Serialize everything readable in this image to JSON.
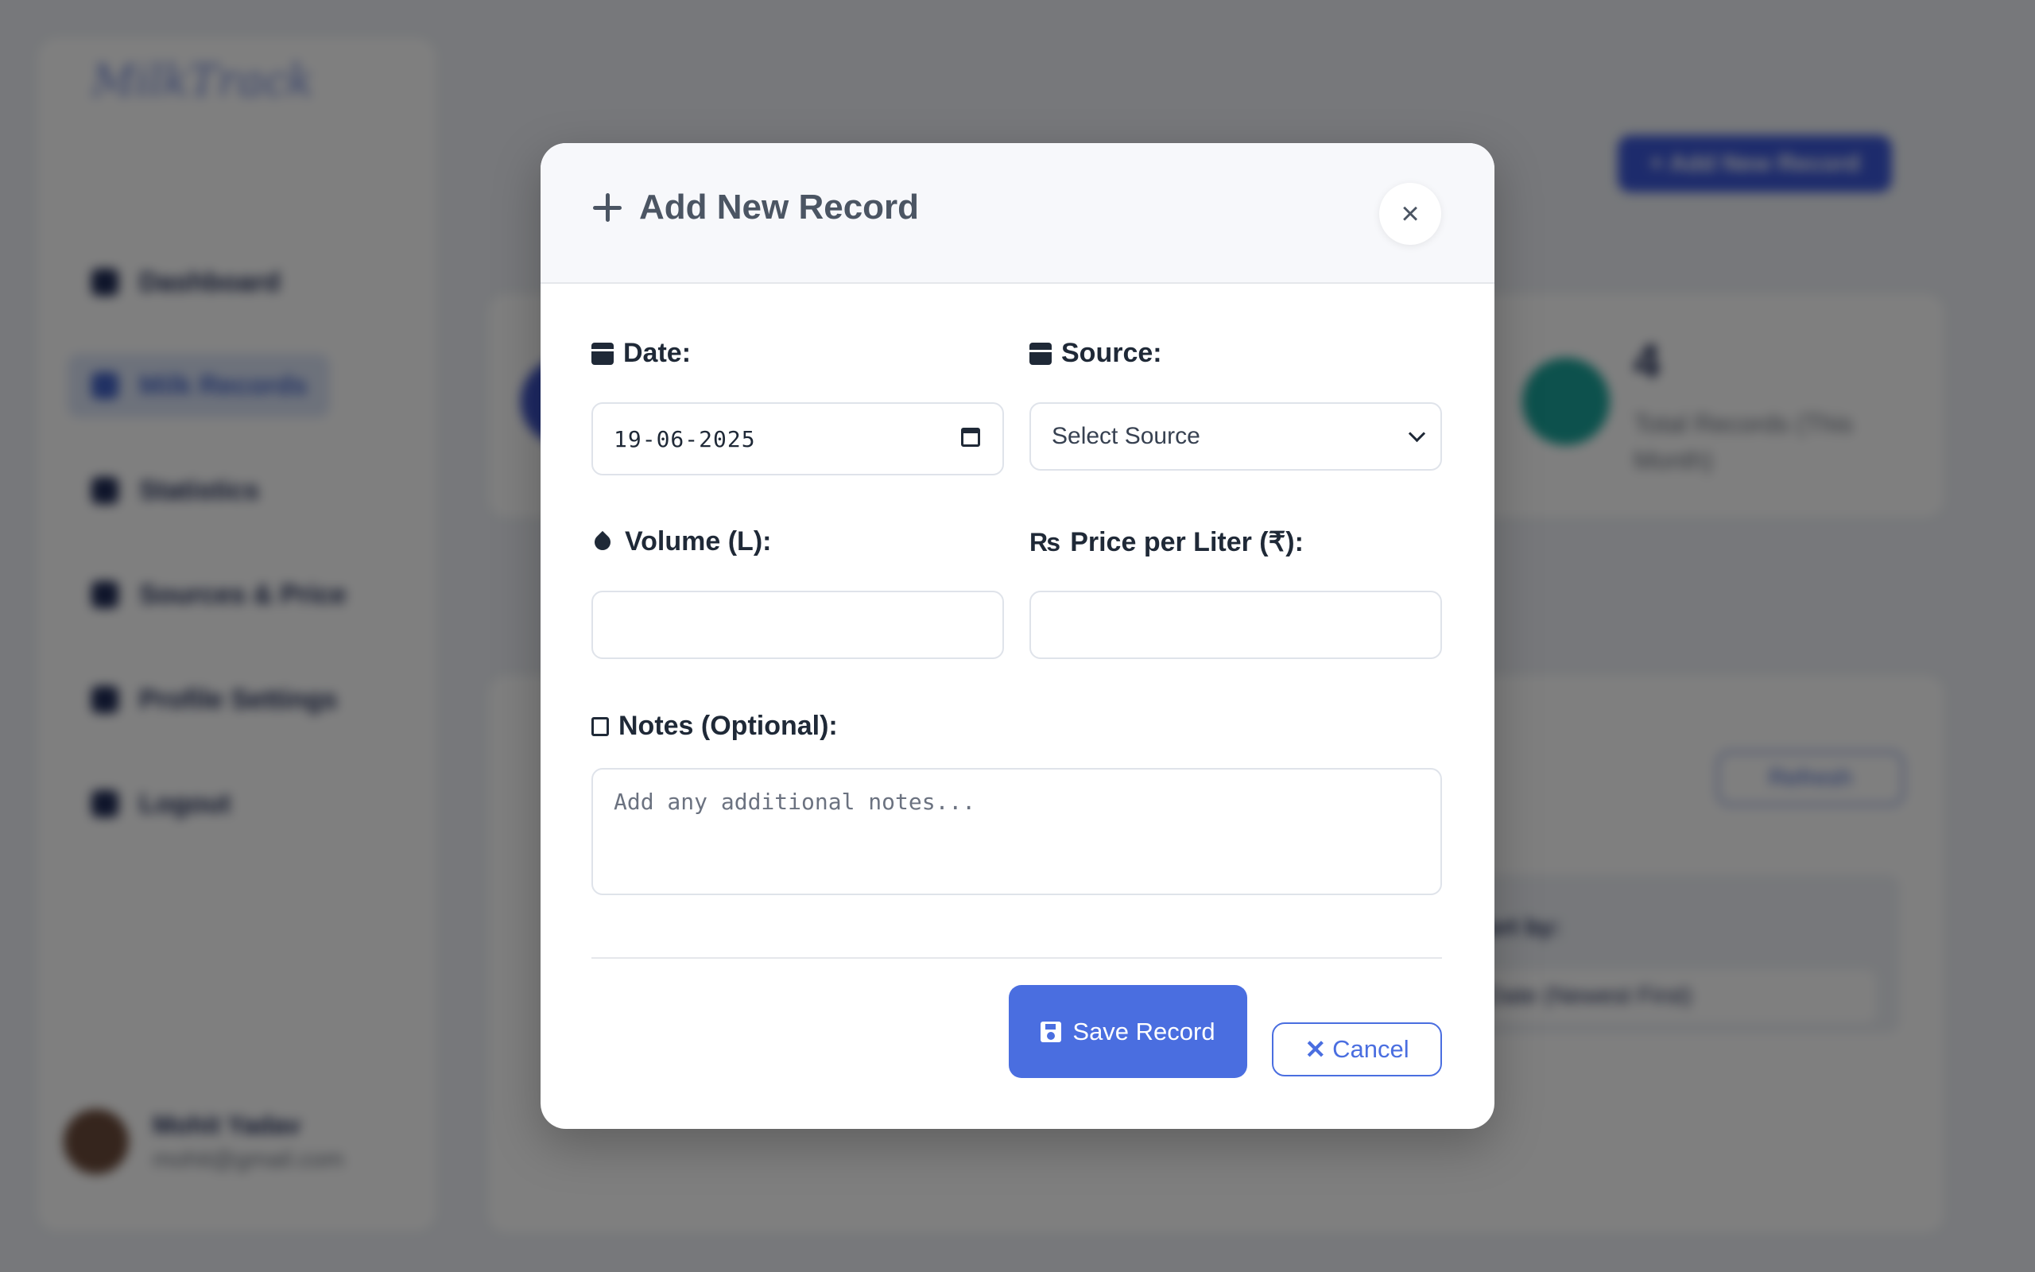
{
  "background": {
    "logo": "MilkTrack",
    "nav": [
      {
        "label": "Dashboard",
        "icon": "home-icon"
      },
      {
        "label": "Milk Records",
        "icon": "glass-icon"
      },
      {
        "label": "Statistics",
        "icon": "chart-icon"
      },
      {
        "label": "Sources & Price",
        "icon": "store-icon"
      },
      {
        "label": "Profile Settings",
        "icon": "user-icon"
      },
      {
        "label": "Logout",
        "icon": "logout-icon"
      }
    ],
    "user": {
      "name": "Mohit Yadav",
      "email": "mohit@gmail.com"
    },
    "add_button": "+ Add New Record",
    "stat": {
      "value": "4",
      "label": "Total Records (This Month)"
    },
    "refresh_button": "Refresh",
    "sort_label": "Sort by:",
    "sort_value": "Date (Newest First)"
  },
  "modal": {
    "title": "Add New Record",
    "close_symbol": "×",
    "date": {
      "label": "Date:",
      "value": "19-06-2025"
    },
    "source": {
      "label": "Source:",
      "selected": "Select Source"
    },
    "volume": {
      "label": "Volume (L):",
      "value": ""
    },
    "price": {
      "label": "Price per Liter (₹):",
      "value": "",
      "icon_glyph": "₨"
    },
    "notes": {
      "label": "Notes (Optional):",
      "placeholder": "Add any additional notes..."
    },
    "save_label": "Save Record",
    "cancel_label": "Cancel",
    "cancel_glyph": "✕"
  },
  "colors": {
    "primary": "#4a6ee0",
    "overlay": "rgba(0,0,0,0.5)",
    "teal_stat": "#1aa39a"
  }
}
